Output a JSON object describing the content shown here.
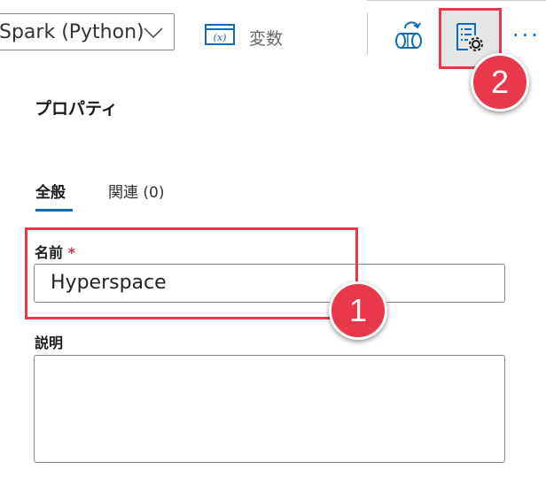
{
  "toolbar": {
    "language_value": "Spark (Python)",
    "variables_label": "変数",
    "variables_icon_text": "(x)",
    "more_label": "···"
  },
  "panel": {
    "title": "プロパティ",
    "tabs": [
      {
        "label": "全般",
        "selected": true
      },
      {
        "label": "関連 (0)",
        "selected": false
      }
    ],
    "name_label": "名前",
    "name_required_mark": "*",
    "name_value": "Hyperspace",
    "description_label": "説明",
    "description_value": ""
  },
  "callouts": [
    {
      "number": "1"
    },
    {
      "number": "2"
    }
  ],
  "colors": {
    "accent": "#0f6cbd",
    "callout": "#e8384a",
    "required": "#c4314b"
  }
}
